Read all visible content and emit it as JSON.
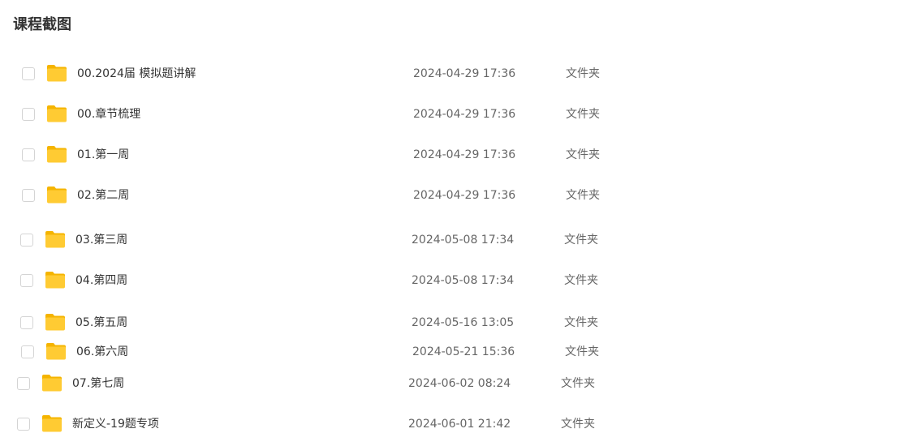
{
  "page": {
    "title": "课程截图"
  },
  "colors": {
    "folder_body": "#FFCB33",
    "folder_tab": "#F5B400",
    "checkbox_border": "#d4d4d4"
  },
  "files": [
    {
      "name": "00.2024届 模拟题讲解",
      "date": "2024-04-29 17:36",
      "type": "文件夹",
      "icon": "folder-icon"
    },
    {
      "name": "00.章节梳理",
      "date": "2024-04-29 17:36",
      "type": "文件夹",
      "icon": "folder-icon"
    },
    {
      "name": "01.第一周",
      "date": "2024-04-29 17:36",
      "type": "文件夹",
      "icon": "folder-icon"
    },
    {
      "name": "02.第二周",
      "date": "2024-04-29 17:36",
      "type": "文件夹",
      "icon": "folder-icon"
    },
    {
      "name": "03.第三周",
      "date": "2024-05-08 17:34",
      "type": "文件夹",
      "icon": "folder-icon"
    },
    {
      "name": "04.第四周",
      "date": "2024-05-08 17:34",
      "type": "文件夹",
      "icon": "folder-icon"
    },
    {
      "name": "05.第五周",
      "date": "2024-05-16 13:05",
      "type": "文件夹",
      "icon": "folder-icon"
    },
    {
      "name": "06.第六周",
      "date": "2024-05-21 15:36",
      "type": "文件夹",
      "icon": "folder-icon"
    },
    {
      "name": "07.第七周",
      "date": "2024-06-02 08:24",
      "type": "文件夹",
      "icon": "folder-icon"
    },
    {
      "name": "新定义-19题专项",
      "date": "2024-06-01 21:42",
      "type": "文件夹",
      "icon": "folder-icon"
    }
  ]
}
